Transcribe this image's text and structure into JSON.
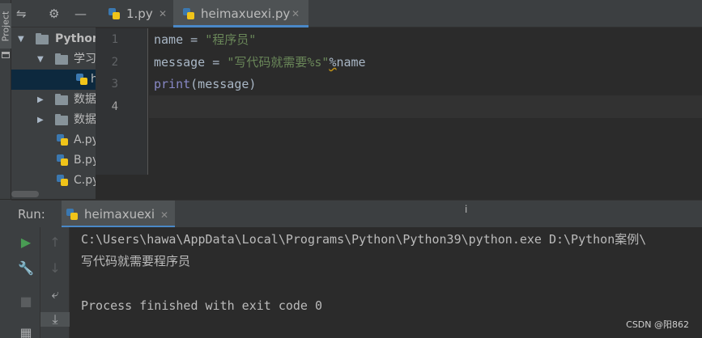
{
  "sidebar": {
    "tab_label": "Project"
  },
  "project_panel": {
    "toolbar_icons": [
      "collapse-all-icon",
      "gear-icon",
      "minimize-icon"
    ],
    "tree": [
      {
        "label": "Python",
        "type": "folder",
        "expanded": true,
        "bold": true
      },
      {
        "label": "学习",
        "type": "folder",
        "expanded": true
      },
      {
        "label": "h",
        "type": "python-file",
        "selected": true
      },
      {
        "label": "数据",
        "type": "folder",
        "expanded": false
      },
      {
        "label": "数据",
        "type": "folder",
        "expanded": false
      },
      {
        "label": "A.py",
        "type": "python-file"
      },
      {
        "label": "B.py",
        "type": "python-file"
      },
      {
        "label": "C.py",
        "type": "python-file"
      }
    ]
  },
  "editor": {
    "tabs": [
      {
        "label": "1.py",
        "active": false
      },
      {
        "label": "heimaxuexi.py",
        "active": true
      }
    ],
    "line_numbers": [
      "1",
      "2",
      "3",
      "4"
    ],
    "current_line": 4,
    "code": {
      "line1": {
        "var": "name",
        "op": " = ",
        "str": "\"程序员\""
      },
      "line2": {
        "var": "message",
        "op": " = ",
        "str": "\"写代码就需要%s\"",
        "pct": "%",
        "rest": "name"
      },
      "line3": {
        "builtin": "print",
        "rest": "(message)"
      }
    }
  },
  "run_panel": {
    "label": "Run:",
    "tab_label": "heimaxuexi",
    "marker": "i",
    "console_lines": [
      "C:\\Users\\hawa\\AppData\\Local\\Programs\\Python\\Python39\\python.exe D:\\Python案例\\",
      "写代码就需要程序员",
      "",
      "Process finished with exit code 0"
    ],
    "toolbar_icons": [
      "run-icon",
      "wrench-icon",
      "stop-icon",
      "layout-icon",
      "up-arrow-icon",
      "down-arrow-icon",
      "soft-wrap-icon",
      "scroll-to-end-icon"
    ]
  },
  "watermark": "CSDN @阳862",
  "colors": {
    "accent": "#4a88c7",
    "string": "#6a8759",
    "builtin": "#8888c6",
    "run_green": "#499c54"
  }
}
